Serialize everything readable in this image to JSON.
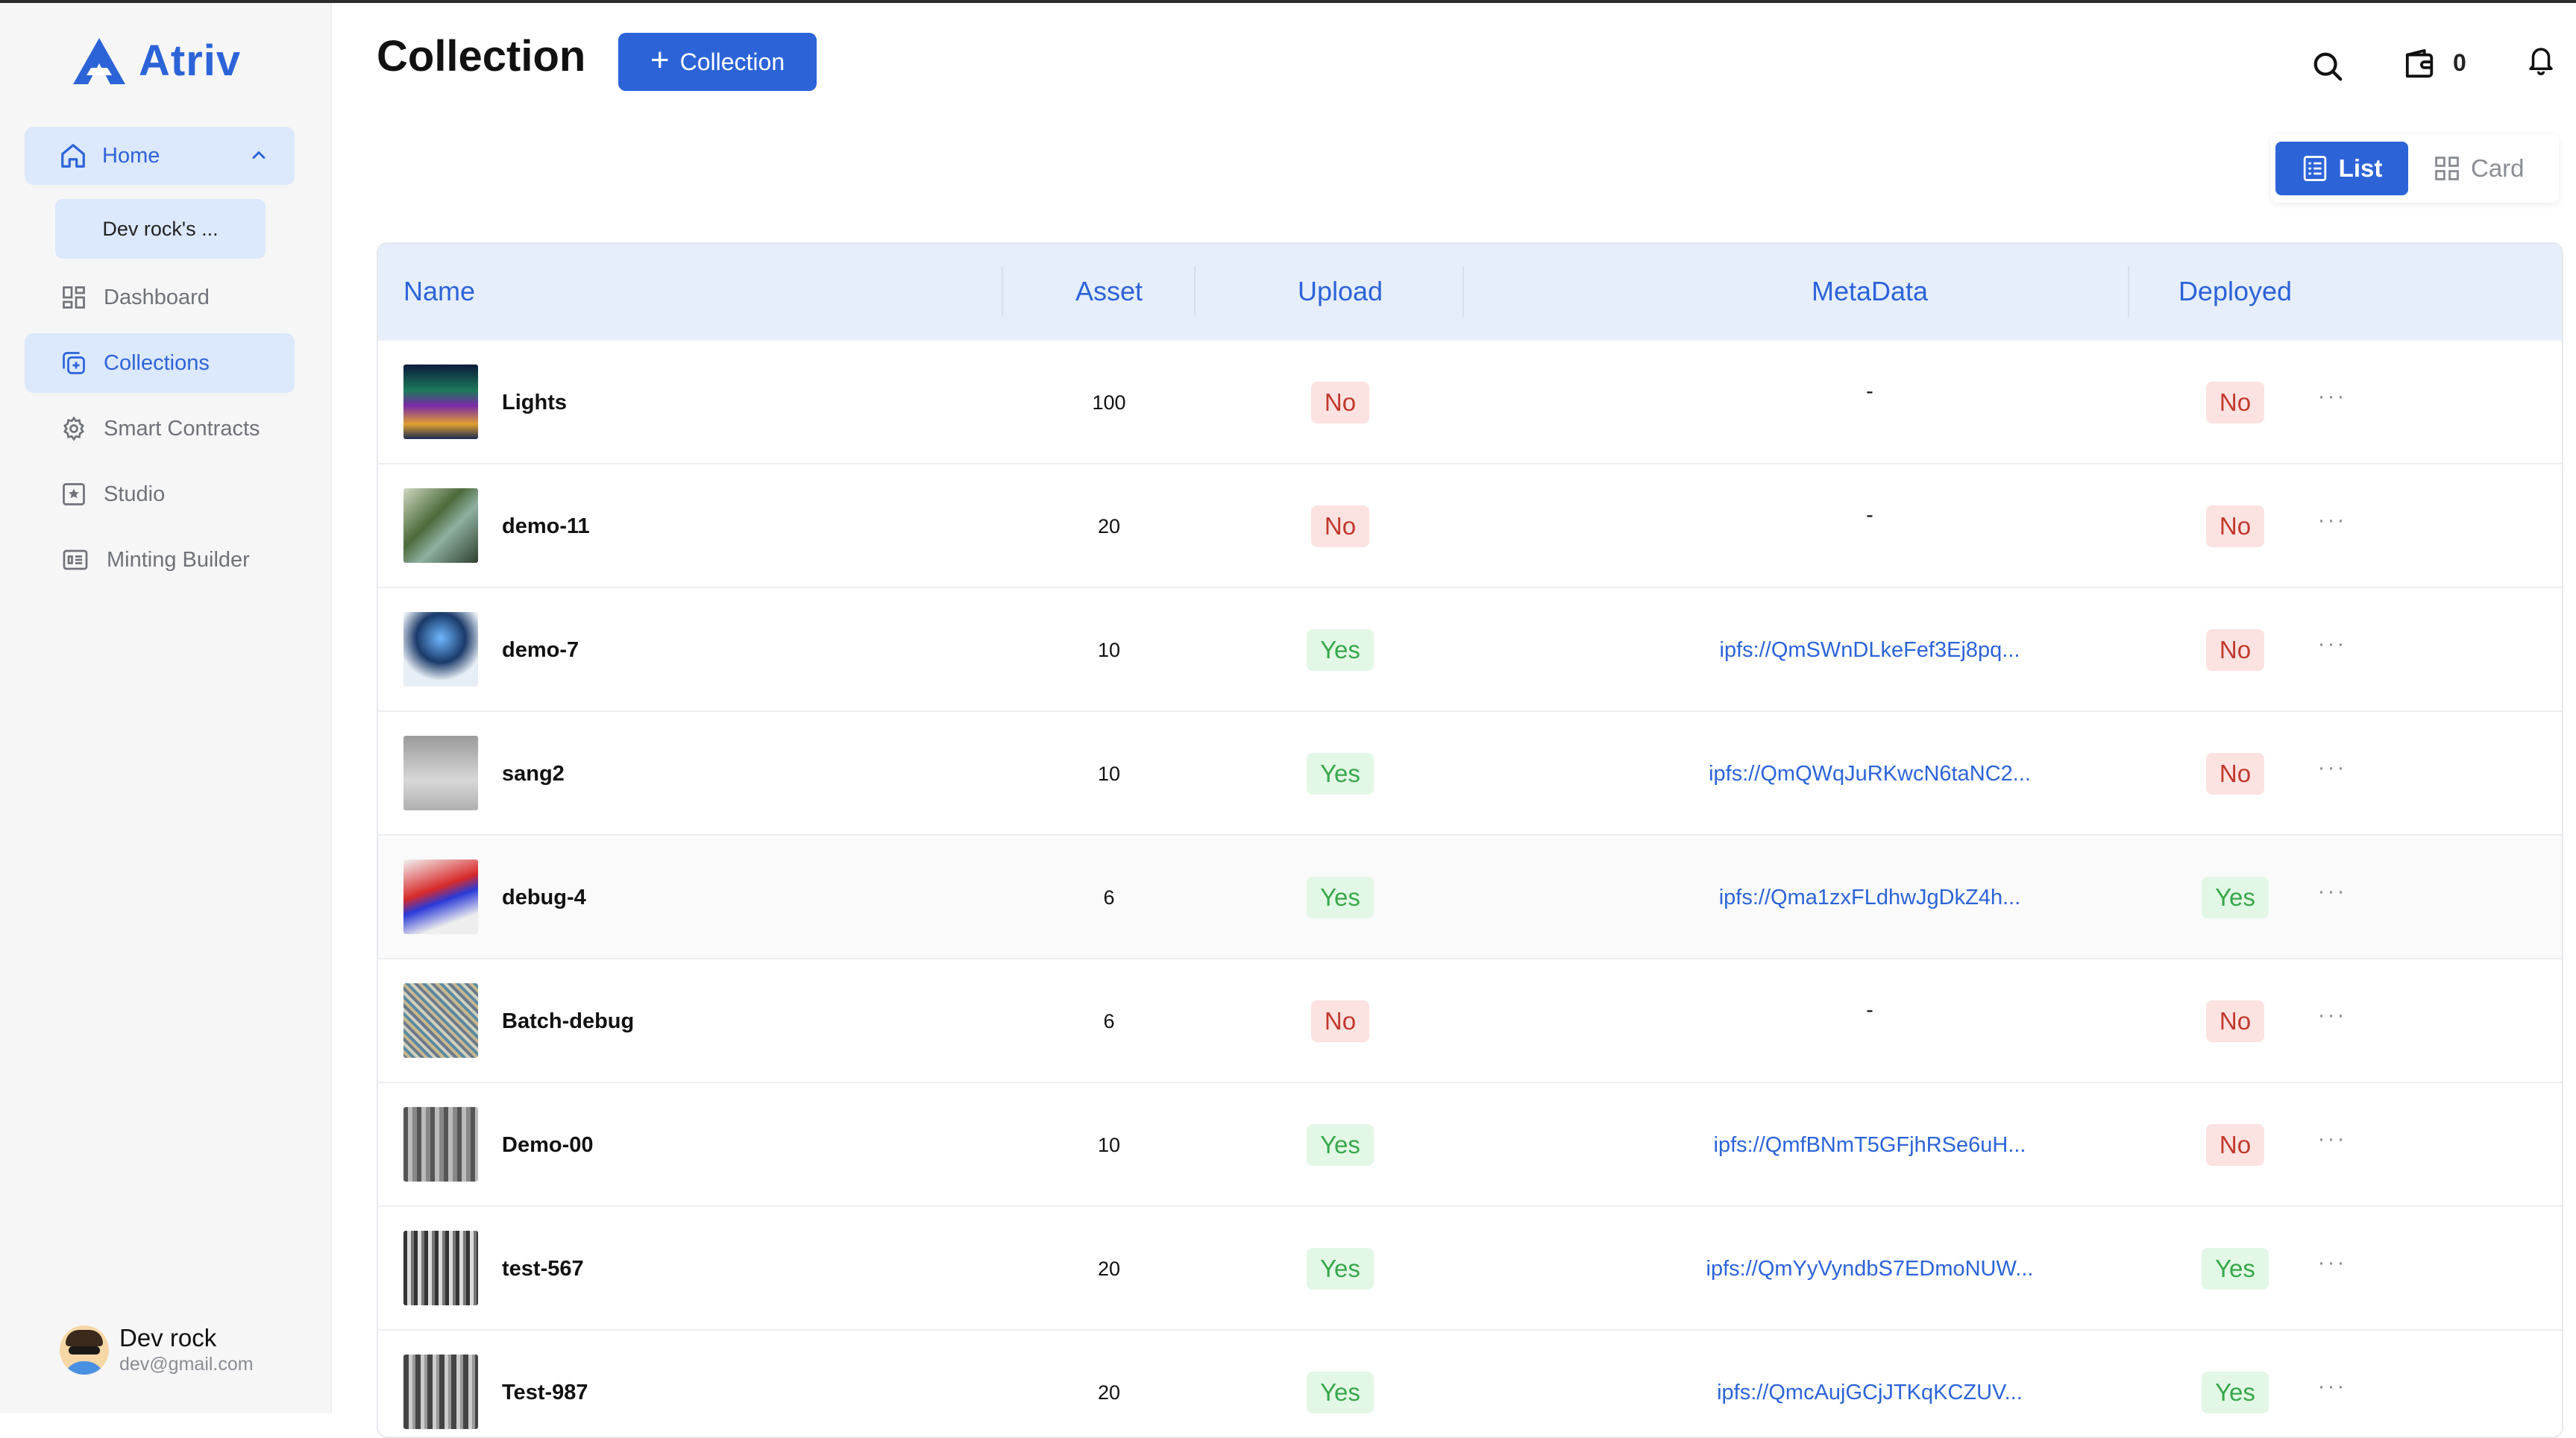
{
  "app": {
    "brand": "Atriv"
  },
  "sidebar": {
    "home_label": "Home",
    "sub_item": "Dev rock's ...",
    "items": [
      {
        "label": "Dashboard",
        "icon": "dashboard-icon",
        "active": false
      },
      {
        "label": "Collections",
        "icon": "collections-icon",
        "active": true
      },
      {
        "label": "Smart Contracts",
        "icon": "smart-contracts-icon",
        "active": false
      },
      {
        "label": "Studio",
        "icon": "studio-icon",
        "active": false
      },
      {
        "label": "Minting Builder",
        "icon": "minting-builder-icon",
        "active": false
      }
    ],
    "user": {
      "name": "Dev rock",
      "email": "dev@gmail.com"
    }
  },
  "header": {
    "title": "Collection",
    "add_button": "Collection",
    "wallet_count": "0"
  },
  "view_toggle": {
    "list": "List",
    "card": "Card",
    "selected": "List"
  },
  "table": {
    "columns": [
      "Name",
      "Asset",
      "Upload",
      "MetaData",
      "Deployed"
    ],
    "rows": [
      {
        "name": "Lights",
        "asset": "100",
        "upload": "No",
        "metadata": "-",
        "deployed": "No"
      },
      {
        "name": "demo-11",
        "asset": "20",
        "upload": "No",
        "metadata": "-",
        "deployed": "No"
      },
      {
        "name": "demo-7",
        "asset": "10",
        "upload": "Yes",
        "metadata": "ipfs://QmSWnDLkeFef3Ej8pq...",
        "deployed": "No"
      },
      {
        "name": "sang2",
        "asset": "10",
        "upload": "Yes",
        "metadata": "ipfs://QmQWqJuRKwcN6taNC2...",
        "deployed": "No"
      },
      {
        "name": "debug-4",
        "asset": "6",
        "upload": "Yes",
        "metadata": "ipfs://Qma1zxFLdhwJgDkZ4h...",
        "deployed": "Yes"
      },
      {
        "name": "Batch-debug",
        "asset": "6",
        "upload": "No",
        "metadata": "-",
        "deployed": "No"
      },
      {
        "name": "Demo-00",
        "asset": "10",
        "upload": "Yes",
        "metadata": "ipfs://QmfBNmT5GFjhRSe6uH...",
        "deployed": "No"
      },
      {
        "name": "test-567",
        "asset": "20",
        "upload": "Yes",
        "metadata": "ipfs://QmYyVyndbS7EDmoNUW...",
        "deployed": "Yes"
      },
      {
        "name": "Test-987",
        "asset": "20",
        "upload": "Yes",
        "metadata": "ipfs://QmcAujGCjJTKqKCZUV...",
        "deployed": "Yes"
      }
    ],
    "row_action_icon": "more-options-icon"
  },
  "colors": {
    "accent": "#2c64d8",
    "active_bg": "#dce8fb",
    "yes_bg": "#e3f7e6",
    "yes_text": "#37a84a",
    "no_bg": "#fde2e2",
    "no_text": "#c0392b"
  }
}
